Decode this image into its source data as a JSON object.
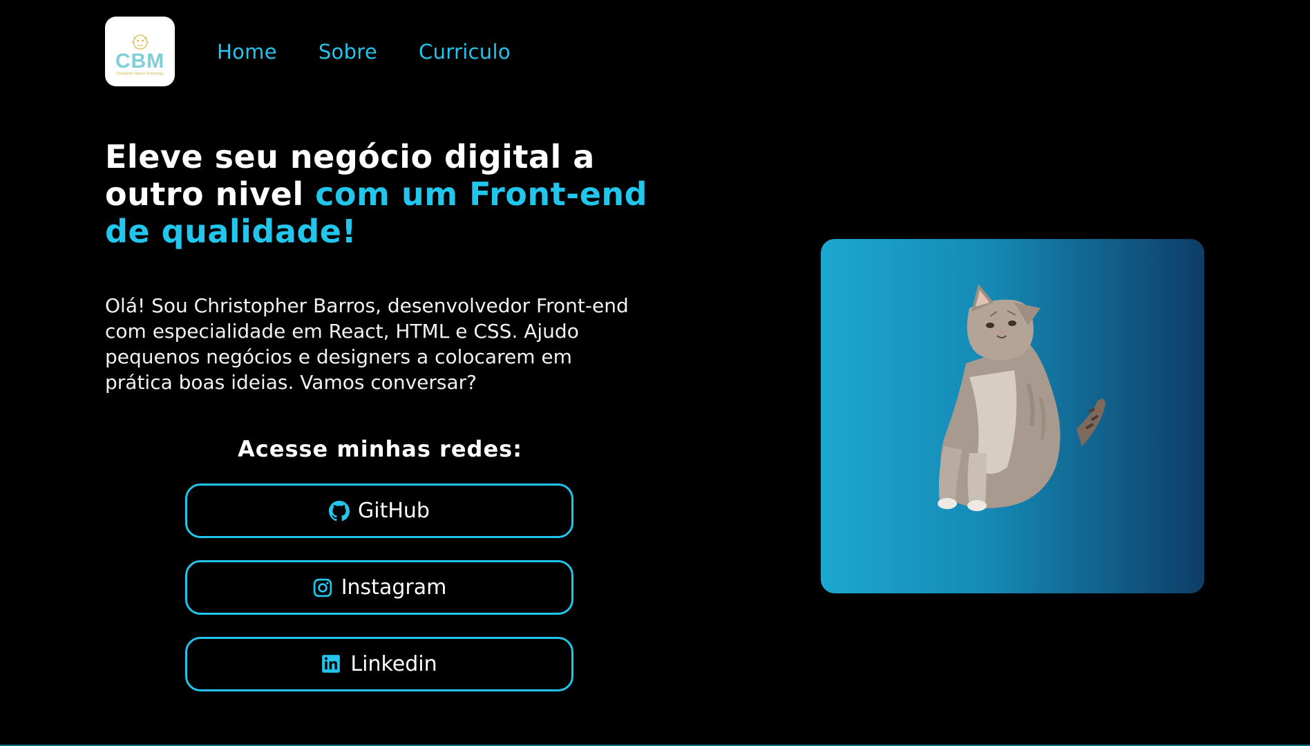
{
  "logo": {
    "text": "CBM",
    "tagline": "Christopher Barros Technology"
  },
  "nav": {
    "items": [
      "Home",
      "Sobre",
      "Curriculo"
    ]
  },
  "hero": {
    "headline_white": "Eleve seu negócio digital a outro nivel ",
    "headline_accent": "com um Front-end de qualidade!",
    "intro": "Olá! Sou Christopher Barros, desenvolvedor Front-end com especialidade em React, HTML e CSS. Ajudo pequenos negócios e designers a colocarem em prática boas ideias. Vamos conversar?"
  },
  "social": {
    "title": "Acesse minhas redes:",
    "buttons": [
      {
        "label": "GitHub",
        "icon": "github-icon"
      },
      {
        "label": "Instagram",
        "icon": "instagram-icon"
      },
      {
        "label": "Linkedin",
        "icon": "linkedin-icon"
      }
    ]
  },
  "image": {
    "subject": "cat-image"
  },
  "colors": {
    "background": "#000000",
    "accent": "#22c5ec",
    "card_gradient_start": "#1ca8d0",
    "card_gradient_end": "#0e3d66"
  }
}
